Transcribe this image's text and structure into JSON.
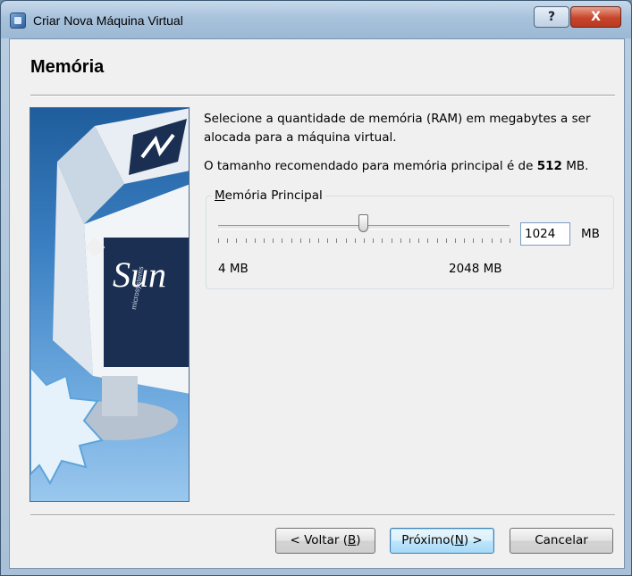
{
  "window": {
    "title": "Criar Nova Máquina Virtual",
    "help_glyph": "?",
    "close_glyph": "X"
  },
  "page": {
    "title": "Memória",
    "description": "Selecione a quantidade de memória (RAM) em megabytes a ser alocada para a máquina virtual.",
    "recommend_prefix": "O tamanho recomendado para memória principal é de ",
    "recommend_value": "512",
    "recommend_suffix": " MB."
  },
  "memory": {
    "group_label_underlined": "M",
    "group_label_rest": "emória Principal",
    "min_label": "4 MB",
    "max_label": "2048 MB",
    "value": "1024",
    "unit": "MB",
    "min_value": 4,
    "max_value": 2048,
    "current_value": 1024
  },
  "banner": {
    "brand": "Sun",
    "brand_sub": "microsystems"
  },
  "buttons": {
    "back_prefix": "< Voltar (",
    "back_key": "B",
    "back_suffix": ")",
    "next_prefix": "Próximo(",
    "next_key": "N",
    "next_suffix": ") >",
    "cancel": "Cancelar"
  },
  "colors": {
    "titlebar": "#a8c2dc",
    "close": "#c7452b",
    "dialog_bg": "#f0f0f0",
    "banner_blue": "#3a7fc2"
  }
}
